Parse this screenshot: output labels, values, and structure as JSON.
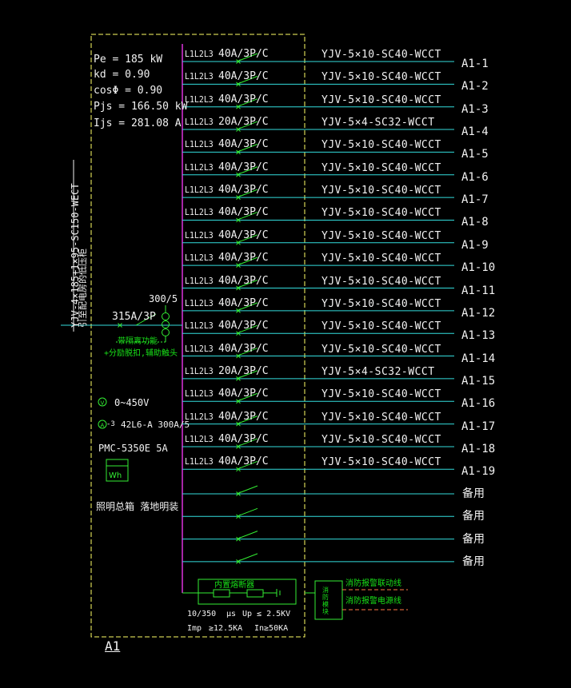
{
  "panel_label": "A1",
  "load_calc": {
    "pe": "Pe = 185 kW",
    "kd": "kd = 0.90",
    "cos": "cosΦ = 0.90",
    "pjs": "Pjs = 166.50 kW",
    "ijs": "Ijs = 281.08 A"
  },
  "incoming": {
    "cable": "YJV-4×185+1×95-SC150-WECT",
    "source": "引至配电房的低压柜",
    "breaker": "315A/3P",
    "ct": "300/5",
    "note1": "带隔离功能",
    "note2": "+分励脱扣,辅助触头"
  },
  "meters": {
    "voltmeter": "0~450V",
    "voltmeter_symbol": "V",
    "ammeter": "42L6-A 300A/5",
    "ammeter_symbol": "A",
    "ammeter_ct_symbol": "-3",
    "energy_meter_model": "PMC-5350E 5A",
    "energy_meter_symbol": "Wh"
  },
  "box_desc": "照明总箱  落地明装",
  "circuits": [
    {
      "phase": "L1L2L3",
      "breaker": "40A/3P/C",
      "cable": "YJV-5×10-SC40-WCCT",
      "name": "A1-1"
    },
    {
      "phase": "L1L2L3",
      "breaker": "40A/3P/C",
      "cable": "YJV-5×10-SC40-WCCT",
      "name": "A1-2"
    },
    {
      "phase": "L1L2L3",
      "breaker": "40A/3P/C",
      "cable": "YJV-5×10-SC40-WCCT",
      "name": "A1-3"
    },
    {
      "phase": "L1L2L3",
      "breaker": "20A/3P/C",
      "cable": "YJV-5×4-SC32-WCCT",
      "name": "A1-4"
    },
    {
      "phase": "L1L2L3",
      "breaker": "40A/3P/C",
      "cable": "YJV-5×10-SC40-WCCT",
      "name": "A1-5"
    },
    {
      "phase": "L1L2L3",
      "breaker": "40A/3P/C",
      "cable": "YJV-5×10-SC40-WCCT",
      "name": "A1-6"
    },
    {
      "phase": "L1L2L3",
      "breaker": "40A/3P/C",
      "cable": "YJV-5×10-SC40-WCCT",
      "name": "A1-7"
    },
    {
      "phase": "L1L2L3",
      "breaker": "40A/3P/C",
      "cable": "YJV-5×10-SC40-WCCT",
      "name": "A1-8"
    },
    {
      "phase": "L1L2L3",
      "breaker": "40A/3P/C",
      "cable": "YJV-5×10-SC40-WCCT",
      "name": "A1-9"
    },
    {
      "phase": "L1L2L3",
      "breaker": "40A/3P/C",
      "cable": "YJV-5×10-SC40-WCCT",
      "name": "A1-10"
    },
    {
      "phase": "L1L2L3",
      "breaker": "40A/3P/C",
      "cable": "YJV-5×10-SC40-WCCT",
      "name": "A1-11"
    },
    {
      "phase": "L1L2L3",
      "breaker": "40A/3P/C",
      "cable": "YJV-5×10-SC40-WCCT",
      "name": "A1-12"
    },
    {
      "phase": "L1L2L3",
      "breaker": "40A/3P/C",
      "cable": "YJV-5×10-SC40-WCCT",
      "name": "A1-13"
    },
    {
      "phase": "L1L2L3",
      "breaker": "40A/3P/C",
      "cable": "YJV-5×10-SC40-WCCT",
      "name": "A1-14"
    },
    {
      "phase": "L1L2L3",
      "breaker": "20A/3P/C",
      "cable": "YJV-5×4-SC32-WCCT",
      "name": "A1-15"
    },
    {
      "phase": "L1L2L3",
      "breaker": "40A/3P/C",
      "cable": "YJV-5×10-SC40-WCCT",
      "name": "A1-16"
    },
    {
      "phase": "L1L2L3",
      "breaker": "40A/3P/C",
      "cable": "YJV-5×10-SC40-WCCT",
      "name": "A1-17"
    },
    {
      "phase": "L1L2L3",
      "breaker": "40A/3P/C",
      "cable": "YJV-5×10-SC40-WCCT",
      "name": "A1-18"
    },
    {
      "phase": "L1L2L3",
      "breaker": "40A/3P/C",
      "cable": "YJV-5×10-SC40-WCCT",
      "name": "A1-19"
    }
  ],
  "spares": [
    "备用",
    "备用",
    "备用",
    "备用"
  ],
  "spd": {
    "label": "内置熔断器",
    "line1a": "10/350",
    "line1b": "μs",
    "line1c": "Up ≤ 2.5KV",
    "line2a": "Imp",
    "line2b": "≥12.5KA",
    "line2c": "In≥50KA"
  },
  "fire": {
    "module": "消防模块",
    "link": "消防报警联动线",
    "power": "消防报警电源线"
  },
  "colors": {
    "background": "#000000",
    "frame_yellow": "#ffff66",
    "busbar_magenta": "#dd33dd",
    "feeder_cyan": "#33dddd",
    "breaker_green": "#33ee33",
    "text_white": "#f2f2f2",
    "fire_orange": "#ff7744"
  }
}
